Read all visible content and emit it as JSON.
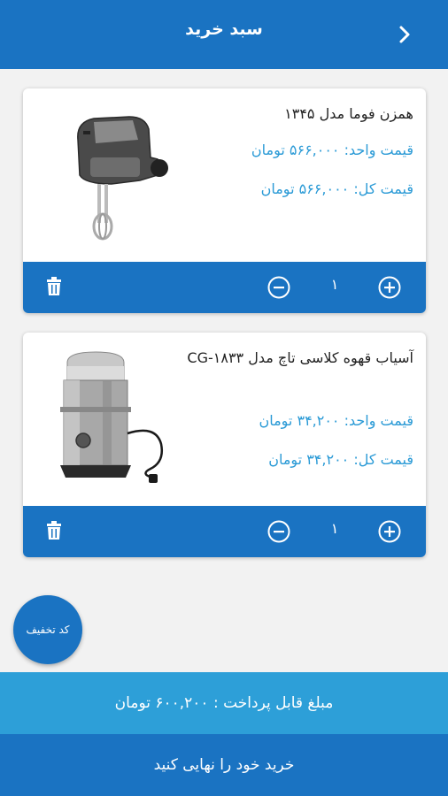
{
  "header": {
    "title": "سبد خرید",
    "back_icon": "chevron-right-icon"
  },
  "items": [
    {
      "name": "همزن فوما مدل ۱۳۴۵",
      "unit_price": "قیمت واحد: ۵۶۶,۰۰۰ تومان",
      "total_price": "قیمت کل: ۵۶۶,۰۰۰ تومان",
      "quantity": "۱",
      "image": "hand-mixer-image"
    },
    {
      "name": "آسیاب قهوه کلاسی تاچ مدل CG-۱۸۳۳",
      "unit_price": "قیمت واحد: ۳۴,۲۰۰ تومان",
      "total_price": "قیمت کل: ۳۴,۲۰۰ تومان",
      "quantity": "۱",
      "image": "coffee-grinder-image"
    }
  ],
  "coupon_label": "کد تخفیف",
  "total_label": "مبلغ قابل پرداخت : ۶۰۰,۲۰۰ تومان",
  "checkout_label": "خرید خود را نهایی کنید",
  "colors": {
    "primary": "#1a73c2",
    "secondary": "#2d9fd8",
    "price": "#2a9ad6"
  }
}
